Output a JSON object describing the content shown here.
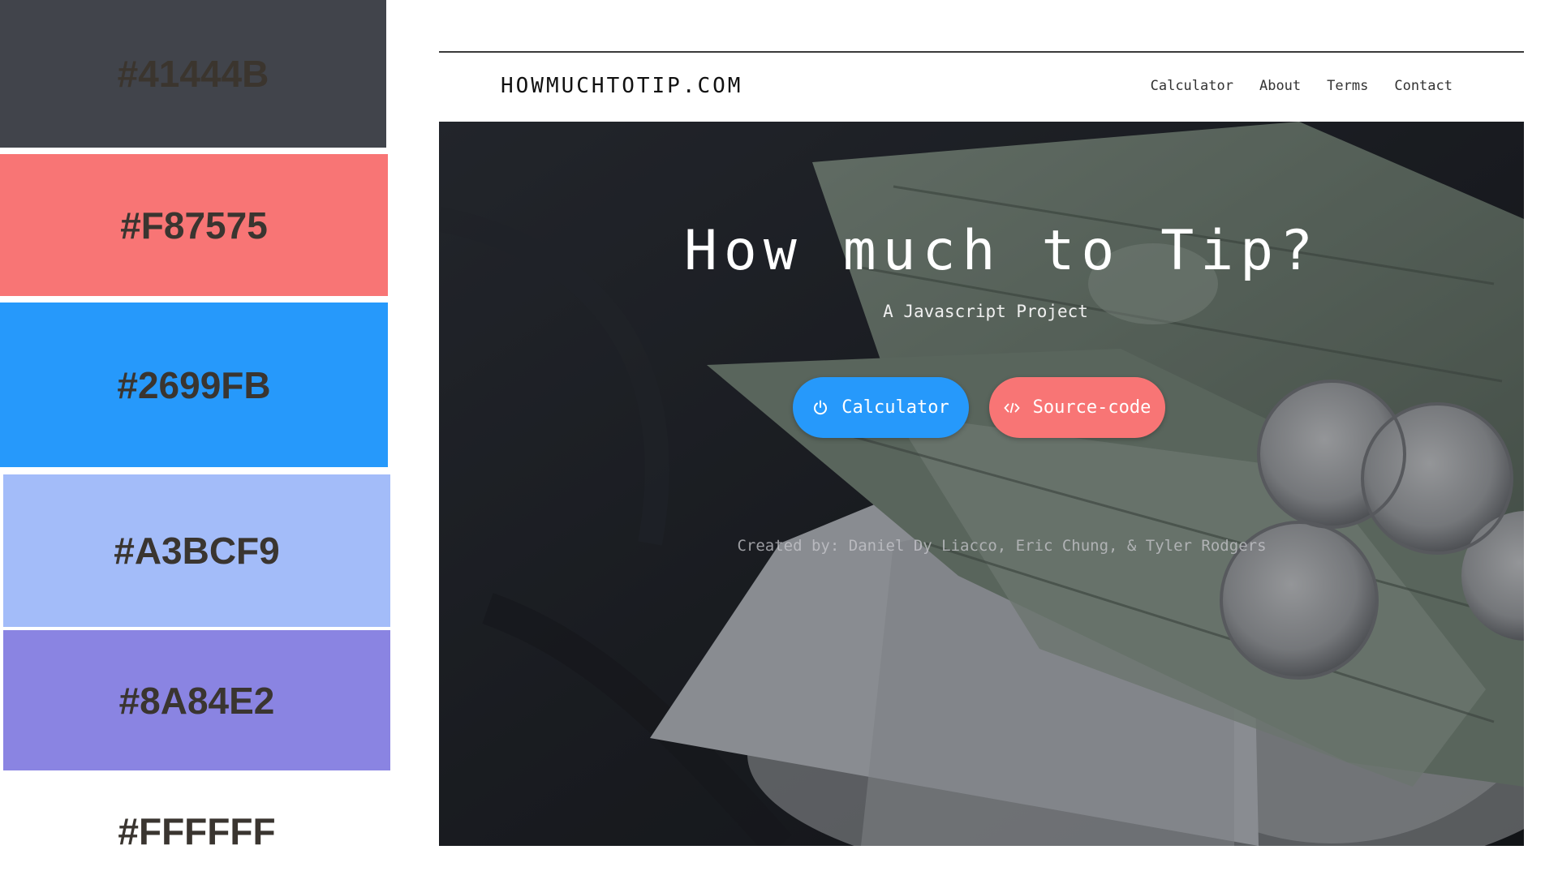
{
  "palette": {
    "swatches": [
      {
        "hex": "#41444B",
        "label": "#41444B"
      },
      {
        "hex": "#F87575",
        "label": "#F87575"
      },
      {
        "hex": "#2699FB",
        "label": "#2699FB"
      },
      {
        "hex": "#A3BCF9",
        "label": "#A3BCF9"
      },
      {
        "hex": "#8A84E2",
        "label": "#8A84E2"
      },
      {
        "hex": "#FFFFFF",
        "label": "#FFFFFF"
      }
    ]
  },
  "site": {
    "brand": "HOWMUCHTOTIP.COM",
    "nav": [
      "Calculator",
      "About",
      "Terms",
      "Contact"
    ],
    "hero": {
      "title": "How much to Tip?",
      "subtitle": "A Javascript Project",
      "buttons": [
        {
          "label": "Calculator",
          "icon": "power-icon",
          "color": "#2699FB"
        },
        {
          "label": "Source-code",
          "icon": "code-icon",
          "color": "#F87575"
        }
      ],
      "credits": "Created by: Daniel Dy Liacco, Eric Chung, & Tyler Rodgers"
    }
  }
}
